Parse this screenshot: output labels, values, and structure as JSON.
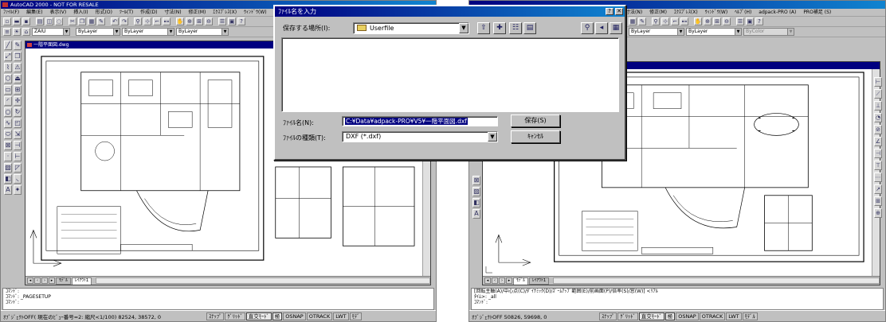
{
  "left_window": {
    "title": "AutoCAD 2000 - NOT FOR RESALE",
    "menu": [
      "ﾌｧｲﾙ(F)",
      "編集(E)",
      "表示(V)",
      "挿入(I)",
      "形式(O)",
      "ﾂｰﾙ(T)",
      "作成(D)",
      "寸法(N)",
      "修正(M)",
      "ｴｸｽﾌﾟﾚｽ(X)",
      "ｳｨﾝﾄﾞｳ(W)",
      "ﾍﾙ"
    ],
    "layer_value": "ZAIU",
    "color_value": "ByLayer",
    "linetype_value": "ByLayer",
    "lineweight_value": "ByLayer",
    "document_title": "一階平面図.dwg",
    "tabs": [
      "ﾓﾃﾞﾙ",
      "ﾚｲｱｳﾄ1"
    ],
    "command_lines": [
      "ｺﾏﾝﾄﾞ:",
      "ｺﾏﾝﾄﾞ: _PAGESETUP",
      "ｺﾏﾝﾄﾞ:"
    ],
    "coordinates": "ｵﾌﾞｼﾞｪｸﾄOFF( 現在のﾋﾞｭｰ番号=2: 縮尺<1/100) 82524, 38572, 0",
    "status_buttons": [
      "ｽﾅｯﾌﾟ",
      "ｸﾞﾘｯﾄﾞ",
      "直交ﾓｰﾄﾞ",
      "極",
      "OSNAP",
      "OTRACK",
      "LWT",
      "ﾓﾃﾞ"
    ]
  },
  "right_window": {
    "menu": [
      "寸法(N)",
      "修正(M)",
      "ｴｸｽﾌﾟﾚｽ(X)",
      "ｳｨﾝﾄﾞｳ(W)",
      "ﾍﾙﾌﾟ(H)",
      "adpack-PRO (A)",
      "PRO補足 (S)"
    ],
    "linetype_value": "ByLayer",
    "lineweight_value": "ByLayer",
    "plotstyle_value": "ByColor",
    "tabs": [
      "ﾓﾃﾞﾙ",
      "ﾚｲｱｳﾄ1"
    ],
    "command_lines": [
      "[回転主軸(A)/中心点(C)/ﾀﾞｲﾅﾐｯｸ(D)/ｽﾞｰﾑｱｯﾌﾟ範囲(E)/前画面(P)/倍率(S)/窓(W)] <ﾘｱﾙ",
      "ﾀｲﾑ>: _all",
      "ｺﾏﾝﾄﾞ:"
    ],
    "coordinates": "ｵﾌﾞｼﾞｪｸﾄOFF 50826, 59698, 0",
    "status_buttons": [
      "ｽﾅｯﾌﾟ",
      "ｸﾞﾘｯﾄﾞ",
      "直交ﾓｰﾄﾞ",
      "極",
      "OSNAP",
      "OTRACK",
      "LWT",
      "ﾓﾃﾞﾙ"
    ]
  },
  "dialog": {
    "title": "ﾌｧｲﾙ名を入力",
    "title_buttons": [
      "?",
      "✕"
    ],
    "location_label": "保存する場所(I):",
    "location_value": "Userfile",
    "filename_label": "ﾌｧｲﾙ名(N):",
    "filename_value": "C:¥Data¥adpack-PRO¥V5¥一階平面図.dxf",
    "filetype_label": "ﾌｧｲﾙの種類(T):",
    "filetype_value": "DXF (*.dxf)",
    "save_button": "保存(S)",
    "cancel_button": "ｷｬﾝｾﾙ"
  },
  "colors": {
    "titlebar": "#000080",
    "face": "#c0c0c0",
    "selection": "#000080"
  }
}
